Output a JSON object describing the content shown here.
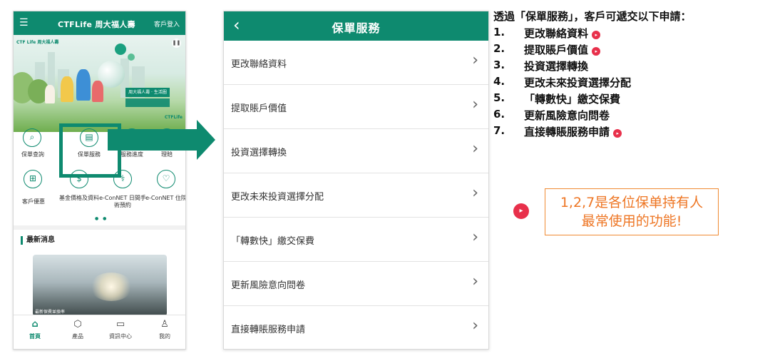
{
  "phone1": {
    "header": {
      "menu_icon": "hamburger-icon",
      "brand": "CTFLife 周大福人壽",
      "login": "客戶登入"
    },
    "banner": {
      "logo": "CTF Life 周大福人壽",
      "slogan": "周大福人壽 · 生活圈",
      "brand_small": "CTFLife"
    },
    "grid": [
      {
        "label": "保單查詢",
        "icon": "search-icon"
      },
      {
        "label": "保單服務",
        "icon": "document-icon"
      },
      {
        "label": "服務進度",
        "icon": "hourglass-icon"
      },
      {
        "label": "理賠",
        "icon": "claim-icon"
      },
      {
        "label": "客戶優惠",
        "icon": "gift-icon"
      },
      {
        "label": "基金價格及資料",
        "icon": "dollar-icon"
      },
      {
        "label": "e-ConNET 日間手術預約",
        "icon": "doctor-icon"
      },
      {
        "label": "e-ConNET 住院",
        "icon": "hospital-icon"
      }
    ],
    "news_title": "最新消息",
    "news_caption": "最新保費並換率",
    "tabs": [
      {
        "label": "首頁",
        "icon": "home-icon",
        "active": true
      },
      {
        "label": "產品",
        "icon": "product-icon",
        "active": false
      },
      {
        "label": "資訊中心",
        "icon": "info-center-icon",
        "active": false
      },
      {
        "label": "我的",
        "icon": "profile-icon",
        "active": false
      }
    ]
  },
  "phone2": {
    "back_icon": "back-arrow-icon",
    "title": "保單服務",
    "items": [
      "更改聯絡資料",
      "提取賬戶價值",
      "投資選擇轉換",
      "更改未來投資選擇分配",
      "「轉數快」繳交保費",
      "更新風險意向問卷",
      "直接轉賬服務申請"
    ]
  },
  "notes": {
    "intro": "透過「保單服務」，客戶可遞交以下申請：",
    "requests": [
      {
        "num": "1.",
        "text": "更改聯絡資料",
        "flag": true
      },
      {
        "num": "2.",
        "text": "提取賬戶價值",
        "flag": true
      },
      {
        "num": "3.",
        "text": "投資選擇轉換",
        "flag": false
      },
      {
        "num": "4.",
        "text": "更改未來投資選擇分配",
        "flag": false
      },
      {
        "num": "5.",
        "text": "「轉數快」繳交保費",
        "flag": false
      },
      {
        "num": "6.",
        "text": "更新風險意向問卷",
        "flag": false
      },
      {
        "num": "7.",
        "text": "直接轉賬服務申請",
        "flag": true
      }
    ],
    "callout_line1": "1,2,7是各位保单持有人",
    "callout_line2": "最常使用的功能!"
  },
  "colors": {
    "brand_green": "#0e8a6f",
    "flag_red": "#e8304b",
    "callout_orange": "#ee7624"
  }
}
